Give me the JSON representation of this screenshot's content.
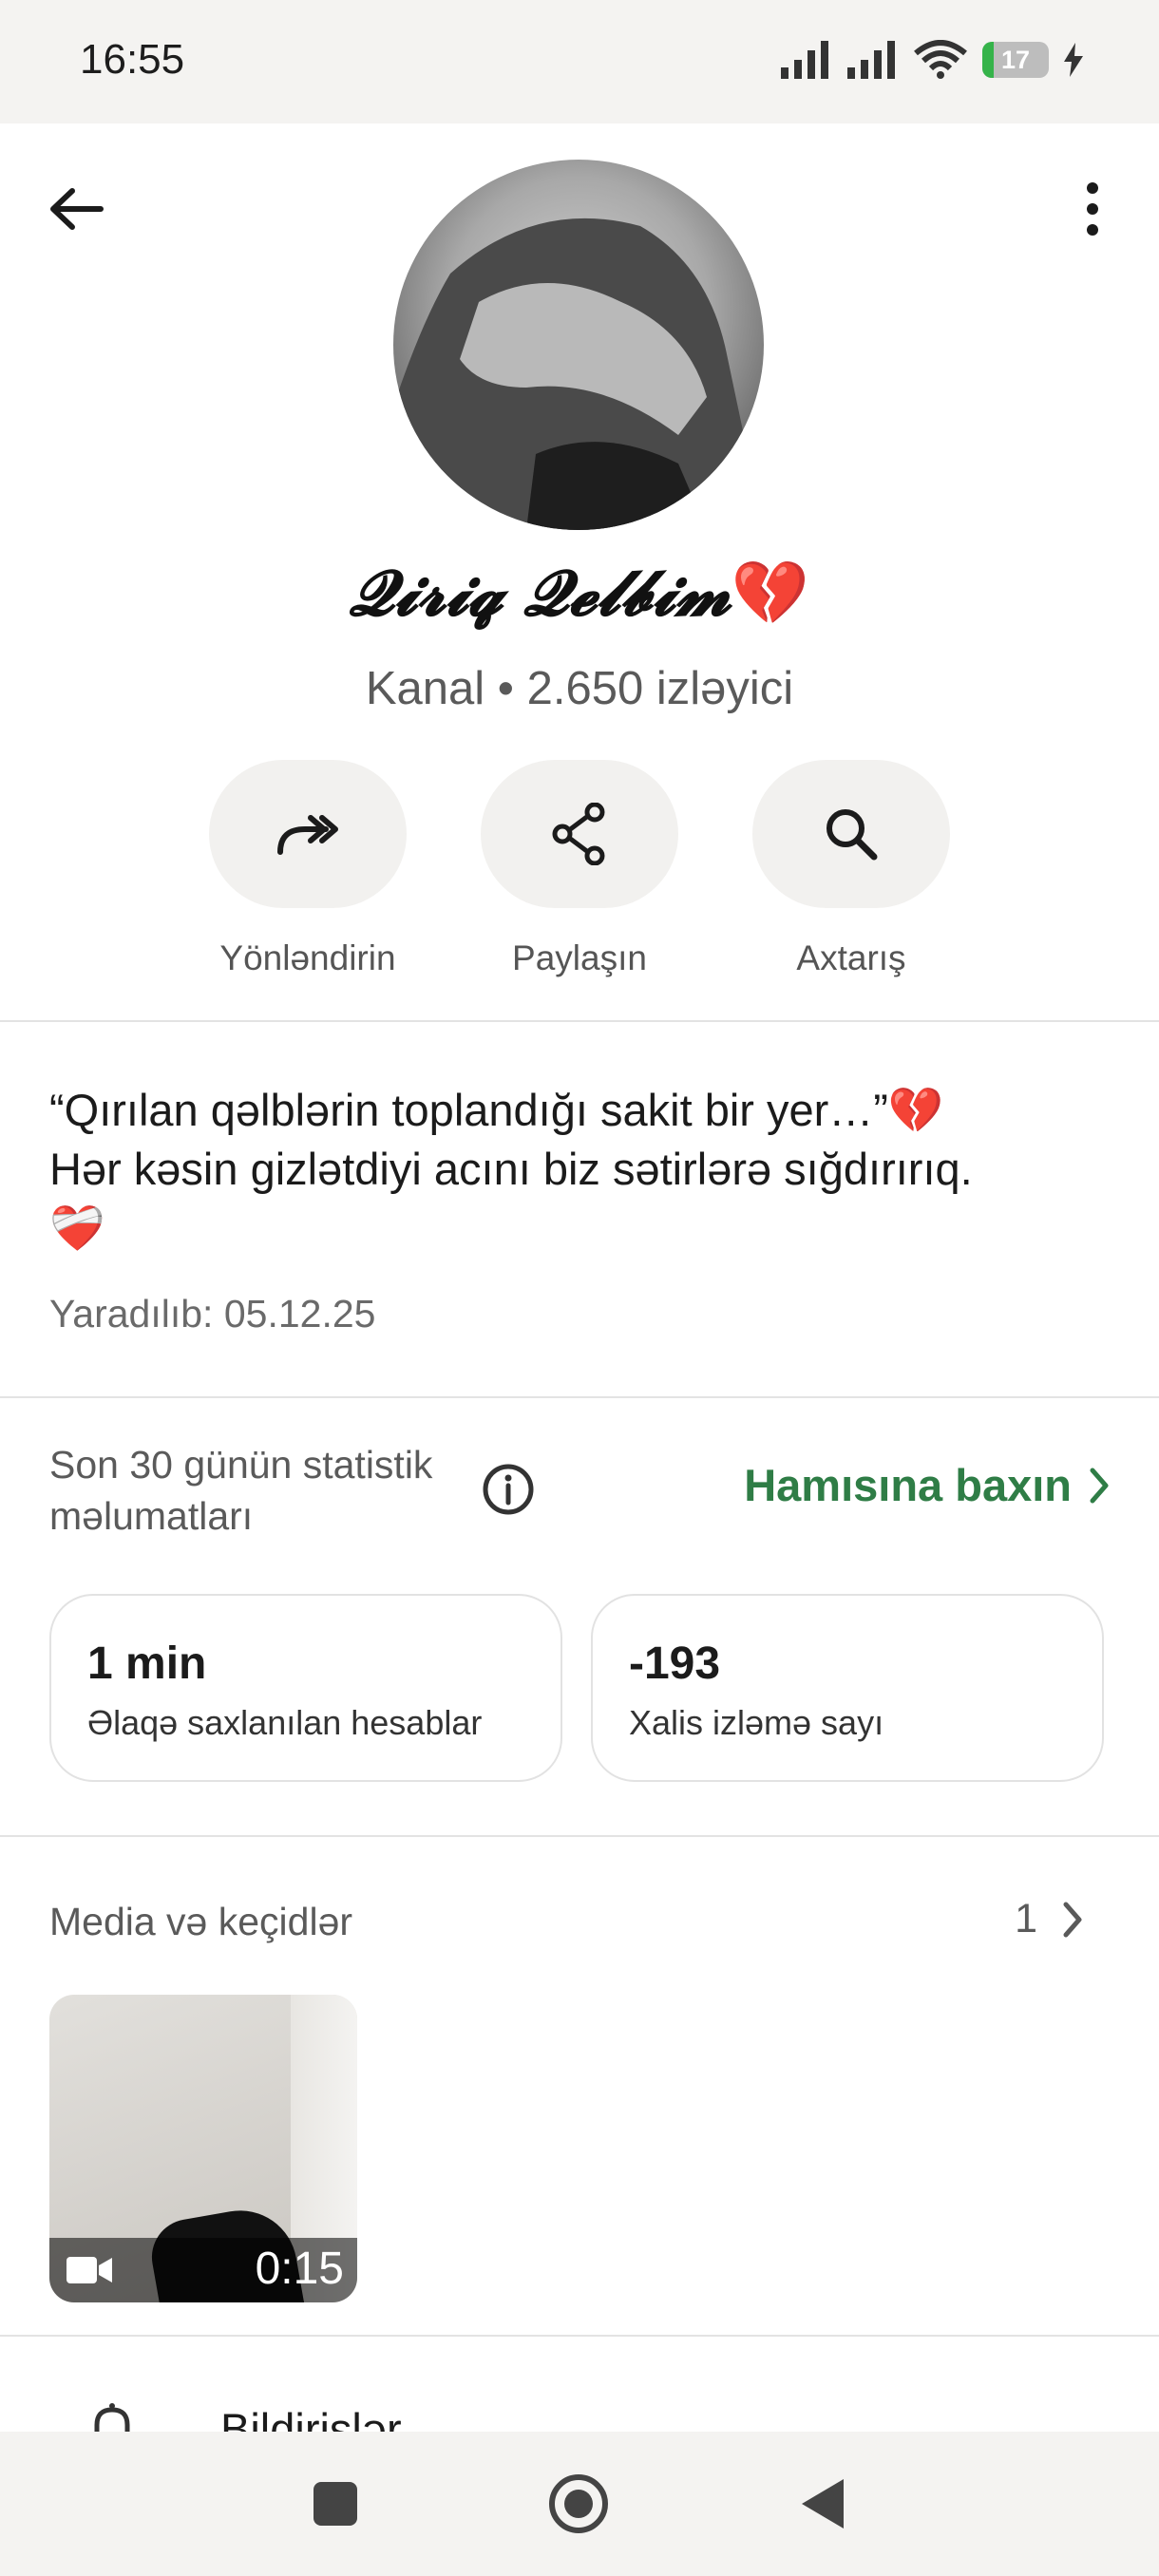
{
  "status_bar": {
    "time": "16:55",
    "battery": "17"
  },
  "header": {
    "channel_name": "𝓠𝓲𝓻𝓲𝓺 𝓠𝓮𝓵𝓫𝓲𝓶",
    "channel_emoji": "💔",
    "channel_meta": "Kanal • 2.650 izləyici"
  },
  "actions": [
    {
      "label": "Yönləndirin",
      "icon": "forward-icon"
    },
    {
      "label": "Paylaşın",
      "icon": "share-icon"
    },
    {
      "label": "Axtarış",
      "icon": "search-icon"
    }
  ],
  "description": {
    "line1": "“Qırılan qəlblərin toplandığı sakit bir yer…”💔",
    "line2": "Hər kəsin gizlətdiyi acını biz sətirlərə sığdırırıq.",
    "line3": "❤️‍🩹",
    "created": "Yaradılıb: 05.12.25"
  },
  "stats": {
    "title": "Son 30 günün statistik məlumatları",
    "see_all": "Hamısına baxın",
    "cards": [
      {
        "value": "1 min",
        "label": "Əlaqə saxlanılan hesablar"
      },
      {
        "value": "-193",
        "label": "Xalis izləmə sayı"
      }
    ]
  },
  "media": {
    "title": "Media və keçidlər",
    "count": "1",
    "items": [
      {
        "duration": "0:15",
        "type": "video-icon"
      }
    ]
  },
  "notifications": {
    "label": "Bildirişlər"
  },
  "colors": {
    "accent": "#2f7d46",
    "battery_fill": "#35b34a"
  }
}
